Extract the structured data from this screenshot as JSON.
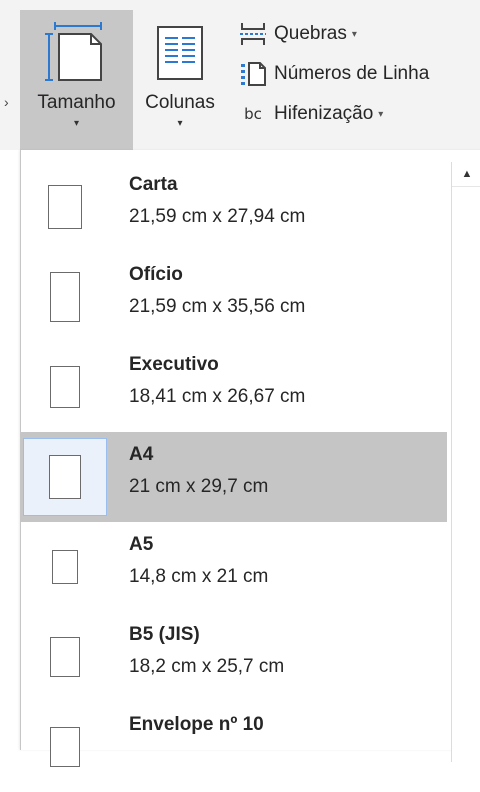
{
  "ribbon": {
    "edge_glyph": "›",
    "tamanho": {
      "label": "Tamanho",
      "arrow": "▾"
    },
    "colunas": {
      "label": "Colunas",
      "arrow": "▾"
    },
    "quebras": {
      "label": "Quebras",
      "arrow": "▾"
    },
    "numeros": {
      "label": "Números de Linha"
    },
    "hifenizacao": {
      "label": "Hifenização",
      "arrow": "▾",
      "icon_text": "bc"
    }
  },
  "sizes": [
    {
      "name": "Carta",
      "dims": "21,59 cm x 27,94 cm",
      "selected": false
    },
    {
      "name": "Ofício",
      "dims": "21,59 cm x 35,56 cm",
      "selected": false
    },
    {
      "name": "Executivo",
      "dims": "18,41 cm x 26,67 cm",
      "selected": false
    },
    {
      "name": "A4",
      "dims": "21 cm x 29,7 cm",
      "selected": true
    },
    {
      "name": "A5",
      "dims": "14,8 cm x 21 cm",
      "selected": false
    },
    {
      "name": "B5 (JIS)",
      "dims": "18,2 cm x 25,7 cm",
      "selected": false
    },
    {
      "name": "Envelope nº 10",
      "dims": "",
      "selected": false
    }
  ],
  "scrollbar": {
    "up_arrow": "▲"
  },
  "colors": {
    "selected_bg": "#c5c5c5",
    "icon_blue": "#2b79d0"
  }
}
